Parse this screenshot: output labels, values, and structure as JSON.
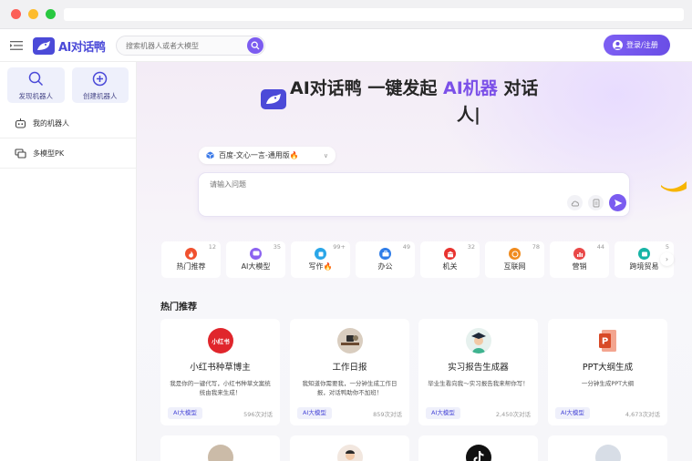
{
  "app": {
    "logo_text": "AI对话鸭",
    "search_placeholder": "搜索机器人或者大模型",
    "login_label": "登录/注册"
  },
  "sidebar": {
    "discover_label": "发现机器人",
    "create_label": "创建机器人",
    "items": [
      {
        "label": "我的机器人",
        "icon": "robot-icon"
      },
      {
        "label": "多模型PK",
        "icon": "compare-icon"
      }
    ]
  },
  "hero": {
    "title_prefix": "AI对话鸭 一键发起 ",
    "title_highlight": "AI机器",
    "title_suffix": " 对话",
    "title_line2": "人|",
    "model_select_value": "百度-文心一言-通用版🔥",
    "chat_placeholder": "请输入问题"
  },
  "categories": [
    {
      "label": "热门推荐",
      "count": "12",
      "color": "#f0512f"
    },
    {
      "label": "AI大模型",
      "count": "35",
      "color": "#8c63f0"
    },
    {
      "label": "写作🔥",
      "count": "99+",
      "color": "#2aa6e8"
    },
    {
      "label": "办公",
      "count": "49",
      "color": "#2f7de8"
    },
    {
      "label": "机关",
      "count": "32",
      "color": "#e8332f"
    },
    {
      "label": "互联网",
      "count": "78",
      "color": "#f08b1d"
    },
    {
      "label": "营销",
      "count": "44",
      "color": "#e94848"
    },
    {
      "label": "跨境贸易",
      "count": "5",
      "color": "#18b4a6"
    }
  ],
  "hot": {
    "title": "热门推荐",
    "cards": [
      {
        "name": "小红书种草博主",
        "desc": "我是你的一键代写，小红书种草文案统统由我来生成！",
        "tag": "AI大模型",
        "count": "596次对话",
        "avatar": "xiaohongshu-logo",
        "avatar_text": "小红书"
      },
      {
        "name": "工作日报",
        "desc": "我知道你需要我，一分钟生成工作日报，对话鸭助你不加班！",
        "tag": "AI大模型",
        "count": "859次对话",
        "avatar": "desk-avatar"
      },
      {
        "name": "实习报告生成器",
        "desc": "毕业生看向我～实习报告我来帮你写！",
        "tag": "AI大模型",
        "count": "2,450次对话",
        "avatar": "graduate-avatar"
      },
      {
        "name": "PPT大纲生成",
        "desc": "一分钟生成PPT大纲",
        "tag": "AI大模型",
        "count": "4,673次对话",
        "avatar": "ppt-icon"
      }
    ]
  }
}
